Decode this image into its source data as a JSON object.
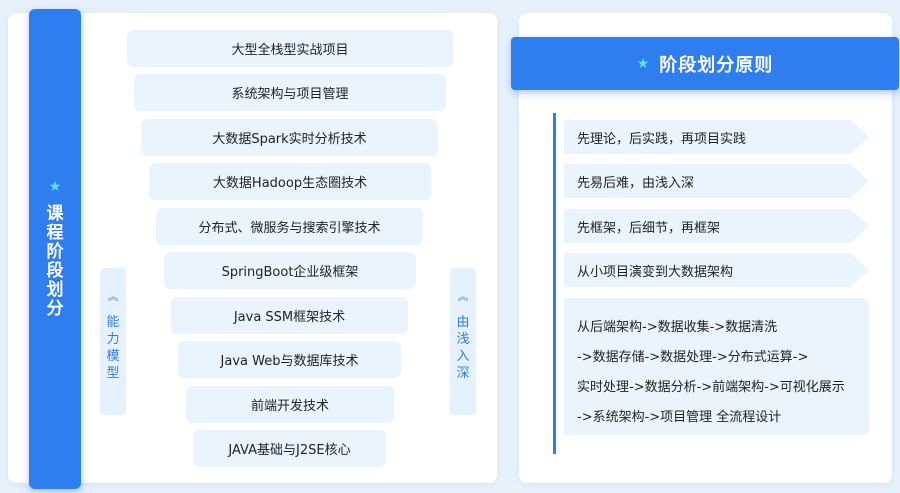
{
  "left": {
    "vertical_title": "课程阶段划分",
    "left_tag": "能力模型",
    "right_tag": "由浅入深",
    "pyramid": [
      "大型全栈型实战项目",
      "系统架构与项目管理",
      "大数据Spark实时分析技术",
      "大数据Hadoop生态圈技术",
      "分布式、微服务与搜索引擎技术",
      "SpringBoot企业级框架",
      "Java SSM框架技术",
      "Java Web与数据库技术",
      "前端开发技术",
      "JAVA基础与J2SE核心"
    ]
  },
  "right": {
    "title": "阶段划分原则",
    "principles": [
      "先理论，后实践，再项目实践",
      "先易后难，由浅入深",
      "先框架，后细节，再框架",
      "从小项目演变到大数据架构"
    ],
    "summary_lines": [
      "从后端架构->数据收集->数据清洗",
      "->数据存储->数据处理->分布式运算->",
      "实时处理->数据分析->前端架构->可视化展示",
      "->系统架构->项目管理 全流程设计"
    ]
  },
  "colors": {
    "accent": "#2f7ef0",
    "star": "#5ce3ee",
    "tile": "#eaf4fd"
  },
  "icons": {
    "star": "★",
    "chevron": "︽"
  }
}
